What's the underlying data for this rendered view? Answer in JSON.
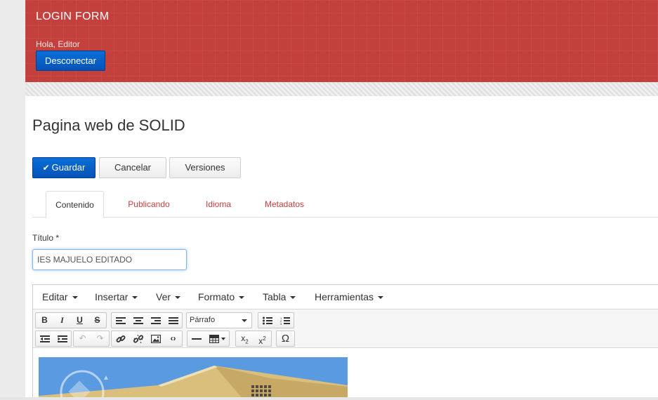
{
  "header": {
    "title": "LOGIN FORM",
    "greeting": "Hola, Editor",
    "logout_label": "Desconectar"
  },
  "page": {
    "title": "Pagina web de SOLID"
  },
  "actions": {
    "save_label": "Guardar",
    "cancel_label": "Cancelar",
    "versions_label": "Versiones"
  },
  "tabs": [
    {
      "label": "Contenido",
      "active": true
    },
    {
      "label": "Publicando",
      "active": false
    },
    {
      "label": "Idioma",
      "active": false
    },
    {
      "label": "Metadatos",
      "active": false
    }
  ],
  "form": {
    "title_label": "Título *",
    "title_value": "IES MAJUELO EDITADO"
  },
  "editor": {
    "menus": [
      "Editar",
      "Insertar",
      "Ver",
      "Formato",
      "Tabla",
      "Herramientas"
    ],
    "format_value": "Párrafo",
    "toolbar_row1_icons": [
      "bold-icon",
      "italic-icon",
      "underline-icon",
      "strikethrough-icon",
      "align-left-icon",
      "align-center-icon",
      "align-right-icon",
      "align-justify-icon",
      "bullet-list-icon",
      "numbered-list-icon"
    ],
    "toolbar_row2_icons": [
      "outdent-icon",
      "indent-icon",
      "undo-icon",
      "redo-icon",
      "link-icon",
      "unlink-icon",
      "image-icon",
      "code-icon",
      "horizontal-rule-icon",
      "table-icon",
      "subscript-icon",
      "superscript-icon",
      "special-char-icon"
    ]
  },
  "colors": {
    "header_bg": "#c3403d",
    "primary_button": "#0a6fd7",
    "tab_link": "#c3403d"
  }
}
